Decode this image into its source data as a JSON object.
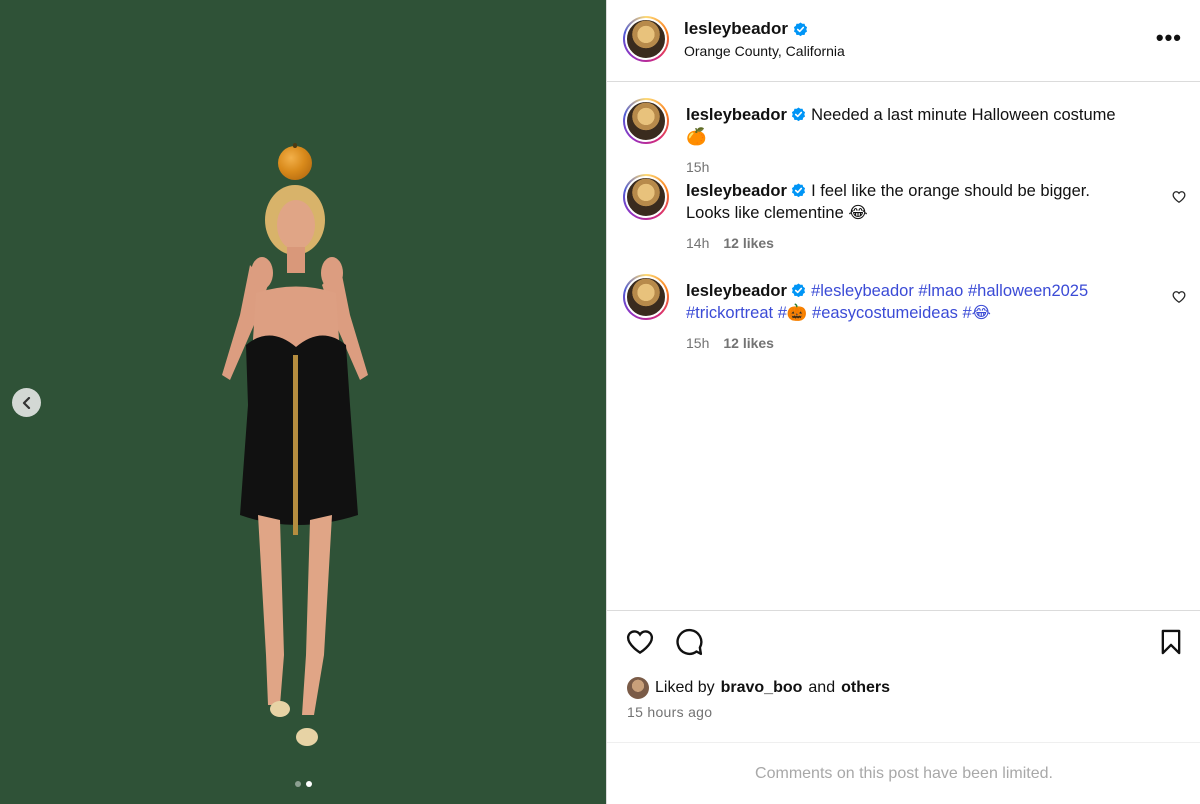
{
  "post": {
    "username": "lesleybeador",
    "location": "Orange County, California",
    "verified": true
  },
  "carousel": {
    "total_slides": 2,
    "active_slide": 2,
    "prev_icon": "chevron-left-icon"
  },
  "comments": [
    {
      "username": "lesleybeador",
      "text": "Needed a last minute Halloween costume 🍊",
      "time": "15h",
      "likes": ""
    },
    {
      "username": "lesleybeador",
      "text": "I feel like the orange should be bigger. Looks like clementine 😂",
      "time": "14h",
      "likes": "12 likes"
    },
    {
      "username": "lesleybeador",
      "tags": [
        "#lesleybeador",
        "#lmao",
        "#halloween2025",
        "#trickortreat",
        "#🎃",
        "#easycostumeideas",
        "#😂"
      ],
      "time": "15h",
      "likes": "12 likes"
    }
  ],
  "actions": {
    "like_icon": "heart-icon",
    "comment_icon": "comment-icon",
    "save_icon": "bookmark-icon"
  },
  "liked_by": {
    "prefix": "Liked by",
    "user": "bravo_boo",
    "joiner": "and",
    "others": "others"
  },
  "posted_ago": "15 hours ago",
  "comments_limited": "Comments on this post have been limited.",
  "colors": {
    "media_bg": "#2f5237",
    "hashtag": "#3b4bd6",
    "verified": "#0095f6",
    "muted": "#737373"
  }
}
